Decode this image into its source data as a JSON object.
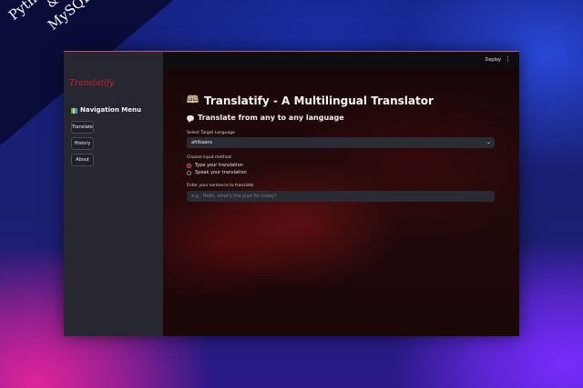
{
  "banner": {
    "line1": "Python",
    "line2": "&",
    "line3": "MySQL"
  },
  "topbar": {
    "deploy_label": "Deploy",
    "menu_glyph": "⋮"
  },
  "sidebar": {
    "logo_text": "Translatify",
    "heading": "Navigation Menu",
    "heading_icon": "books-icon",
    "items": [
      {
        "label": "Translate"
      },
      {
        "label": "History"
      },
      {
        "label": "About"
      }
    ]
  },
  "main": {
    "title": "Translatify - A Multilingual Translator",
    "title_icon": "🕮",
    "subtitle": "Translate from any to any language",
    "target_language": {
      "label": "Select Target Language",
      "value": "afrikaans"
    },
    "input_method": {
      "label": "Choose input method:",
      "options": [
        "Type your translation",
        "Speak your translation"
      ],
      "selected_index": 0
    },
    "sentence": {
      "label": "Enter your sentence to translate",
      "placeholder": "e.g., Hello, what's the plan for today?"
    }
  },
  "colors": {
    "accent": "#ff4b4b",
    "sidebar_bg": "#262730",
    "window_border": "#e64a55"
  }
}
